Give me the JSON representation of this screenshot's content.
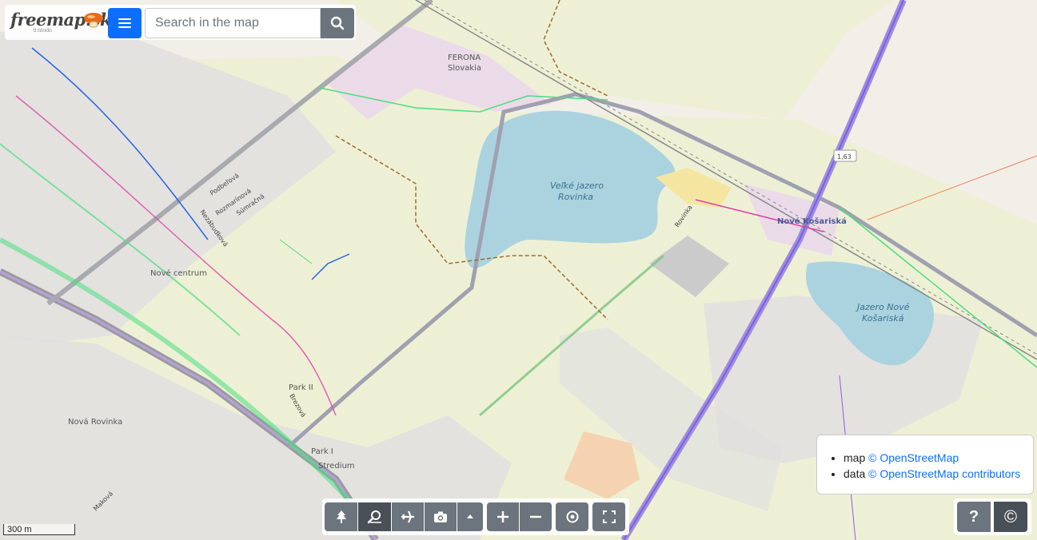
{
  "app": {
    "logo_text": "freemap.sk",
    "logo_sub": "ti ntodo"
  },
  "search": {
    "placeholder": "Search in the map",
    "value": ""
  },
  "map": {
    "labels": {
      "ferona": "FERONA",
      "slovakia": "Slovakia",
      "lake_big_1": "Veľké jazero",
      "lake_big_2": "Rovinka",
      "nove_kosariska": "Nové Košariská",
      "lake_small_1": "Jazero Nové",
      "lake_small_2": "Košariská",
      "nove_centrum": "Nové centrum",
      "park2": "Park II",
      "park1": "Park I",
      "stredium": "Stredium",
      "nova_rovinka": "Nová Rovinka",
      "rovinka_street": "Rovinka",
      "podbelova": "Podbeľová",
      "nezabudkova": "Nezábudková",
      "rozmarinova": "Rozmarínová",
      "sumracna": "Súmračná",
      "brezova": "Brezová",
      "makova": "Maková",
      "road_number": "1,63"
    },
    "colors": {
      "land": "#f2efe9",
      "farmland": "#eef0d5",
      "water": "#aad3df",
      "industrial": "#ebdbe8",
      "residential": "#e0dfdf",
      "track_purple": "#8a5cf5",
      "track_green": "#4ade80",
      "track_magenta": "#e03ca8",
      "track_blue": "#2563eb"
    }
  },
  "toolbar": {
    "buttons": [
      {
        "name": "tree-icon"
      },
      {
        "name": "search-map-icon",
        "active": true
      },
      {
        "name": "plane-icon"
      },
      {
        "name": "camera-icon"
      },
      {
        "name": "caret-up-icon"
      },
      {
        "name": "zoom-in-icon"
      },
      {
        "name": "zoom-out-icon"
      },
      {
        "name": "locate-icon"
      },
      {
        "name": "fullscreen-icon"
      }
    ]
  },
  "attribution": {
    "map_prefix": "map ",
    "map_link": "© OpenStreetMap",
    "data_prefix": "data ",
    "data_link": "© OpenStreetMap contributors"
  },
  "help": {
    "help_label": "?",
    "copyright_label": "©"
  },
  "scale": {
    "label": "300 m"
  }
}
